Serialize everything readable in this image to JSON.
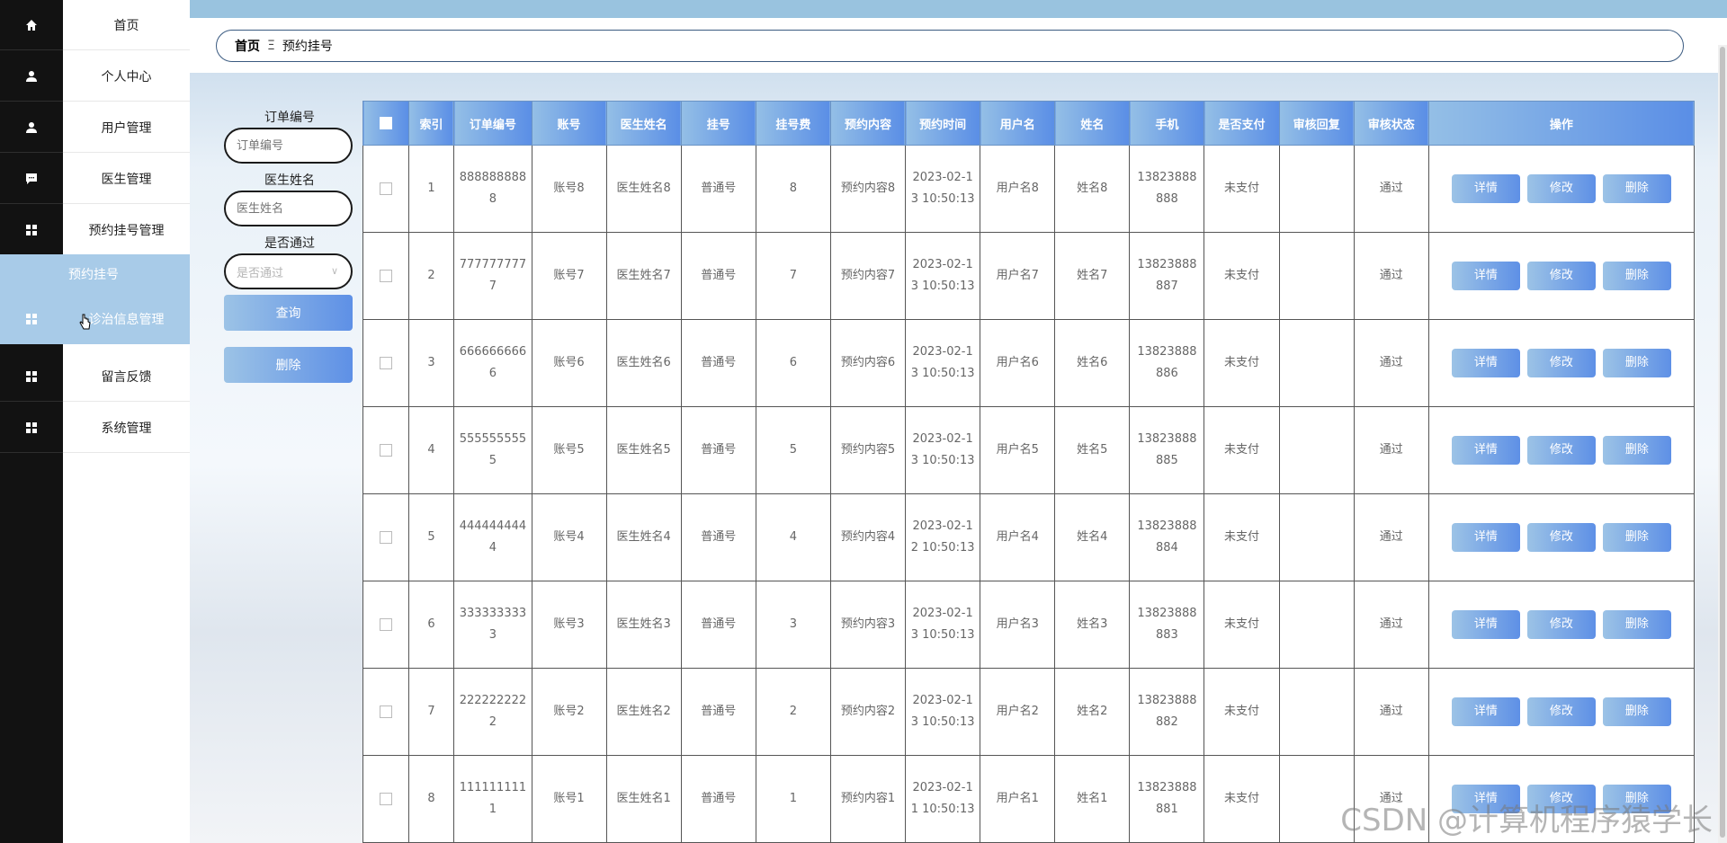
{
  "sidebar": {
    "items": [
      {
        "label": "首页",
        "icon": "home-icon"
      },
      {
        "label": "个人中心",
        "icon": "user-icon"
      },
      {
        "label": "用户管理",
        "icon": "user-icon"
      },
      {
        "label": "医生管理",
        "icon": "chat-icon"
      },
      {
        "label": "预约挂号管理",
        "icon": "grid-icon"
      },
      {
        "label": "诊治信息管理",
        "icon": "grid-icon"
      },
      {
        "label": "留言反馈",
        "icon": "grid-icon"
      },
      {
        "label": "系统管理",
        "icon": "grid-icon"
      }
    ],
    "submenu_label": "预约挂号",
    "active_index": 5,
    "active_color": "#a8cbe8"
  },
  "breadcrumb": {
    "home": "首页",
    "separator": "Ξ",
    "current": "预约挂号"
  },
  "search": {
    "order_no_label": "订单编号",
    "order_no_placeholder": "订单编号",
    "doctor_label": "医生姓名",
    "doctor_placeholder": "医生姓名",
    "passed_label": "是否通过",
    "passed_placeholder": "是否通过",
    "query_button": "查询",
    "delete_button": "删除"
  },
  "table": {
    "headers": [
      "",
      "索引",
      "订单编号",
      "账号",
      "医生姓名",
      "挂号",
      "挂号费",
      "预约内容",
      "预约时间",
      "用户名",
      "姓名",
      "手机",
      "是否支付",
      "审核回复",
      "审核状态",
      "操作"
    ],
    "rows": [
      [
        "1",
        "8888888888",
        "账号8",
        "医生姓名8",
        "普通号",
        "8",
        "预约内容8",
        "2023-02-13 10:50:13",
        "用户名8",
        "姓名8",
        "13823888888",
        "未支付",
        "",
        "通过"
      ],
      [
        "2",
        "7777777777",
        "账号7",
        "医生姓名7",
        "普通号",
        "7",
        "预约内容7",
        "2023-02-13 10:50:13",
        "用户名7",
        "姓名7",
        "13823888887",
        "未支付",
        "",
        "通过"
      ],
      [
        "3",
        "6666666666",
        "账号6",
        "医生姓名6",
        "普通号",
        "6",
        "预约内容6",
        "2023-02-13 10:50:13",
        "用户名6",
        "姓名6",
        "13823888886",
        "未支付",
        "",
        "通过"
      ],
      [
        "4",
        "5555555555",
        "账号5",
        "医生姓名5",
        "普通号",
        "5",
        "预约内容5",
        "2023-02-13 10:50:13",
        "用户名5",
        "姓名5",
        "13823888885",
        "未支付",
        "",
        "通过"
      ],
      [
        "5",
        "4444444444",
        "账号4",
        "医生姓名4",
        "普通号",
        "4",
        "预约内容4",
        "2023-02-12 10:50:13",
        "用户名4",
        "姓名4",
        "13823888884",
        "未支付",
        "",
        "通过"
      ],
      [
        "6",
        "3333333333",
        "账号3",
        "医生姓名3",
        "普通号",
        "3",
        "预约内容3",
        "2023-02-13 10:50:13",
        "用户名3",
        "姓名3",
        "13823888883",
        "未支付",
        "",
        "通过"
      ],
      [
        "7",
        "2222222222",
        "账号2",
        "医生姓名2",
        "普通号",
        "2",
        "预约内容2",
        "2023-02-13 10:50:13",
        "用户名2",
        "姓名2",
        "13823888882",
        "未支付",
        "",
        "通过"
      ],
      [
        "8",
        "1111111111",
        "账号1",
        "医生姓名1",
        "普通号",
        "1",
        "预约内容1",
        "2023-02-11 10:50:13",
        "用户名1",
        "姓名1",
        "13823888881",
        "未支付",
        "",
        "通过"
      ]
    ],
    "row_actions": [
      "详情",
      "修改",
      "删除"
    ]
  },
  "watermark": "CSDN @计算机程序猿学长"
}
